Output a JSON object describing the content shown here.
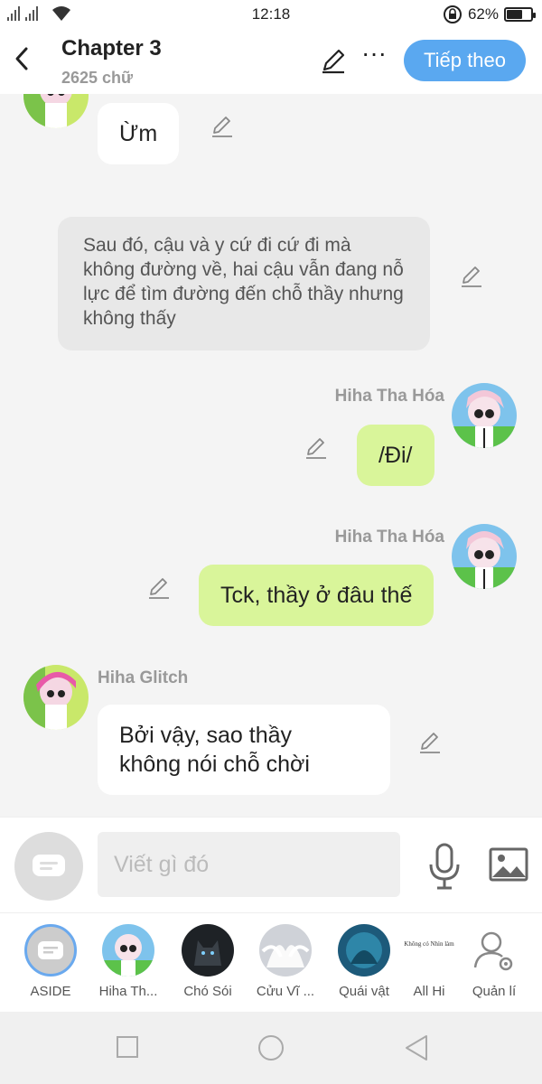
{
  "status": {
    "time": "12:18",
    "battery": "62%",
    "battery_level": 0.62
  },
  "header": {
    "title": "Chapter 3",
    "subtitle": "2625 chữ",
    "next_label": "Tiếp theo"
  },
  "messages": [
    {
      "type": "char_left",
      "sender": "",
      "text": "Ừm"
    },
    {
      "type": "narration",
      "text": "Sau đó, cậu và y cứ đi cứ đi mà không đường về, hai cậu vẫn đang nỗ lực để tìm đường đến chỗ thầy nhưng không thấy"
    },
    {
      "type": "char_right",
      "sender": "Hiha Tha Hóa",
      "text": "/Đi/"
    },
    {
      "type": "char_right",
      "sender": "Hiha Tha Hóa",
      "text": "Tck, thầy ở đâu thế"
    },
    {
      "type": "char_left",
      "sender": "Hiha Glitch",
      "text_lines": [
        "Bởi vậy, sao thầy",
        "không nói chỗ chời"
      ]
    }
  ],
  "composer": {
    "placeholder": "Viết gì đó"
  },
  "characters": [
    {
      "name": "ASIDE"
    },
    {
      "name": "Hiha Th..."
    },
    {
      "name": "Chó Sói"
    },
    {
      "name": "Cửu Vĩ ..."
    },
    {
      "name": "Quái vật"
    },
    {
      "name": "All Hi",
      "thumb_text": "Không có Nhìn làm"
    },
    {
      "name": "Quản lí"
    }
  ],
  "colors": {
    "accent": "#5aa8f0",
    "bubble_green": "#d9f59a",
    "narration_bg": "#e8e8e8"
  }
}
